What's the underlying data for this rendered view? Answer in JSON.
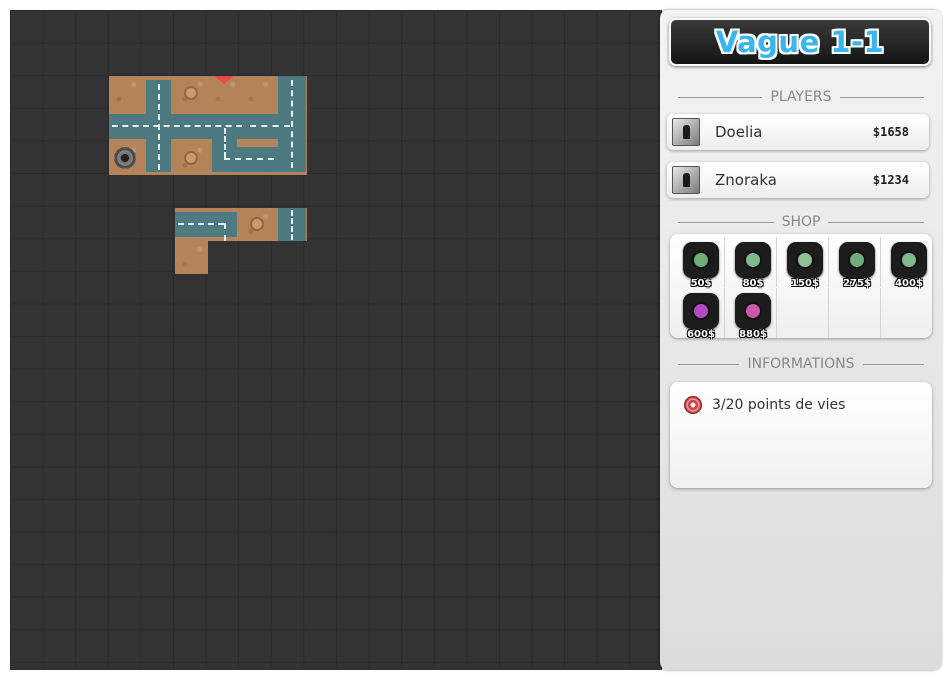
{
  "wave": {
    "title": "Vague 1-1"
  },
  "sections": {
    "players": "PLAYERS",
    "shop": "SHOP",
    "informations": "INFORMATIONS"
  },
  "players": [
    {
      "name": "Doelia",
      "money": "$1658"
    },
    {
      "name": "Znoraka",
      "money": "$1234"
    }
  ],
  "shop": {
    "towers": [
      {
        "price": "50$",
        "color": "#6fae79"
      },
      {
        "price": "80$",
        "color": "#7fb88a"
      },
      {
        "price": "150$",
        "color": "#8fc096"
      },
      {
        "price": "275$",
        "color": "#6fae79"
      },
      {
        "price": "400$",
        "color": "#7fb88a"
      },
      {
        "price": "600$",
        "color": "#b04bc4"
      },
      {
        "price": "880$",
        "color": "#c45aa8"
      }
    ]
  },
  "info": {
    "lives": "3/20 points de vies"
  },
  "colors": {
    "accent": "#3ab6ef",
    "board": "#333333",
    "ground": "#b5835a",
    "road": "#4d7a80"
  }
}
